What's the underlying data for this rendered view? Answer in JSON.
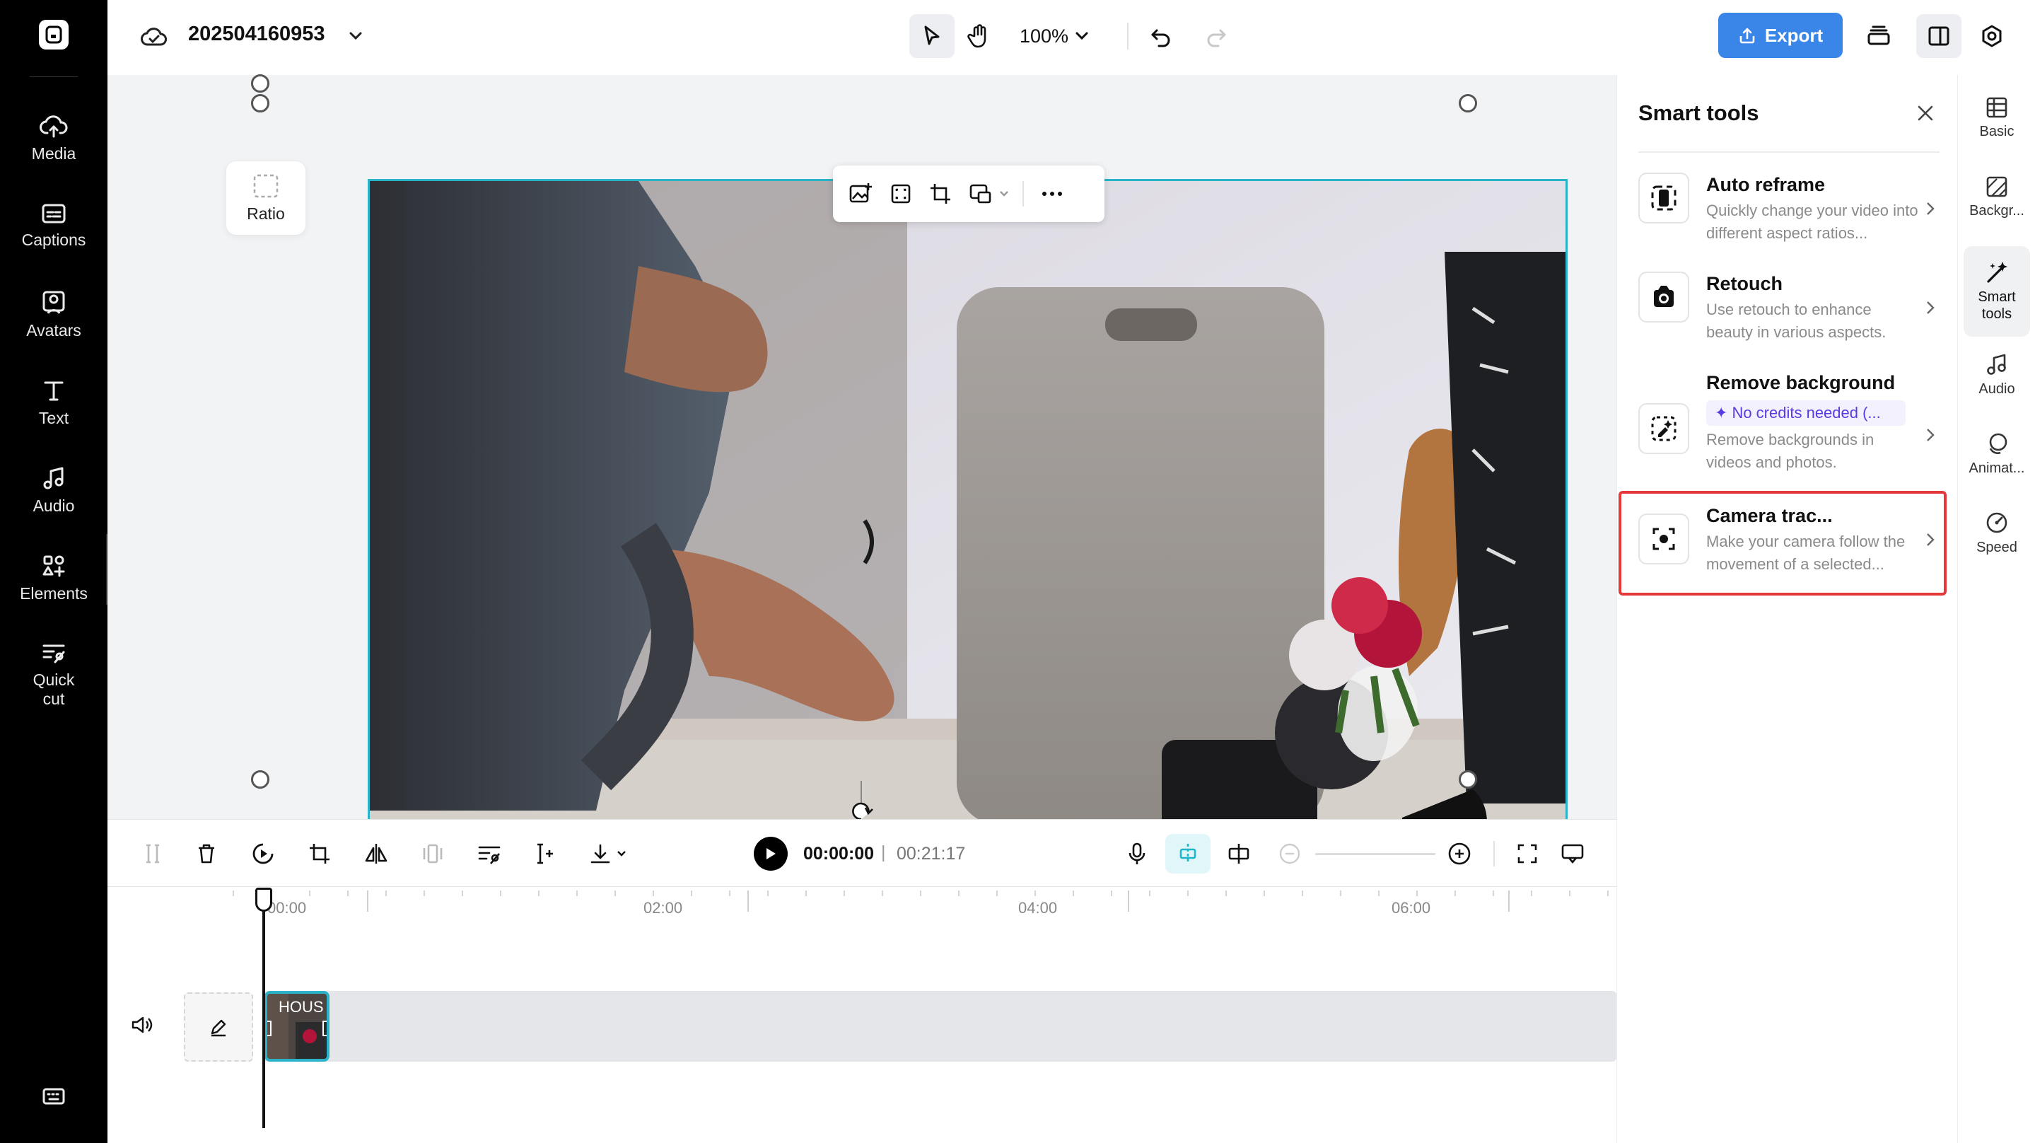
{
  "app": {
    "name": "CapCut"
  },
  "header": {
    "project_name": "202504160953",
    "zoom": "100%",
    "export_label": "Export"
  },
  "leftnav": [
    {
      "label": "Media",
      "icon": "cloud-upload-icon"
    },
    {
      "label": "Captions",
      "icon": "captions-icon"
    },
    {
      "label": "Avatars",
      "icon": "avatar-icon"
    },
    {
      "label": "Text",
      "icon": "text-icon"
    },
    {
      "label": "Audio",
      "icon": "music-note-icon"
    },
    {
      "label": "Elements",
      "icon": "elements-icon"
    },
    {
      "label": "Quick cut",
      "icon": "quick-cut-icon"
    }
  ],
  "canvas": {
    "ratio_label": "Ratio"
  },
  "playback": {
    "current_time": "00:00:00",
    "separator": "|",
    "total_time": "00:21:17"
  },
  "timeline": {
    "ruler_labels": [
      "00:00",
      "02:00",
      "04:00",
      "06:00"
    ],
    "clip_label": "HOUS"
  },
  "smart_tools": {
    "title": "Smart tools",
    "tools": [
      {
        "title": "Auto reframe",
        "description": "Quickly change your video into different aspect ratios...",
        "icon": "auto-reframe-icon"
      },
      {
        "title": "Retouch",
        "description": "Use retouch to enhance beauty in various aspects.",
        "icon": "retouch-icon"
      },
      {
        "title": "Remove background",
        "badge": "No credits needed (...",
        "description": "Remove backgrounds in videos and photos.",
        "icon": "remove-background-icon"
      },
      {
        "title": "Camera trac...",
        "description": "Make your camera follow the movement of a selected...",
        "icon": "camera-tracking-icon",
        "highlighted": true
      }
    ]
  },
  "rightrail": [
    {
      "label": "Basic",
      "icon": "basic-icon"
    },
    {
      "label": "Backgr...",
      "icon": "background-icon"
    },
    {
      "label": "Smart tools",
      "icon": "magic-wand-icon",
      "active": true
    },
    {
      "label": "Audio",
      "icon": "music-note-icon"
    },
    {
      "label": "Animat...",
      "icon": "animation-icon"
    },
    {
      "label": "Speed",
      "icon": "speed-icon"
    }
  ],
  "colors": {
    "accent": "#3a86e8",
    "selection": "#2ab3c9",
    "highlight_border": "#e5383b",
    "sidebar": "#000000",
    "credit_text": "#5a3be0"
  }
}
